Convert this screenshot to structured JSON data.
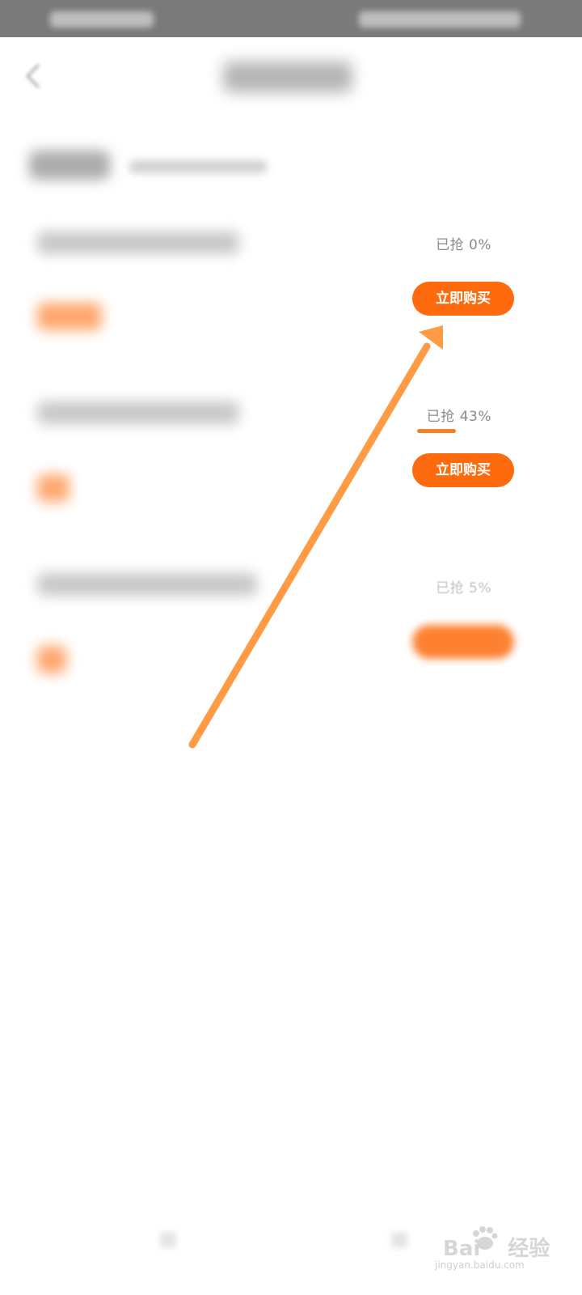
{
  "items": [
    {
      "grabbed": "已抢 0%",
      "progress": 0,
      "button": "立即购买"
    },
    {
      "grabbed": "已抢 43%",
      "progress": 0.43,
      "button": "立即购买"
    },
    {
      "grabbed": "已抢 5%",
      "progress": 0.05,
      "button": ""
    }
  ],
  "colors": {
    "accent": "#fe6b0e",
    "arrow": "#ff9a45"
  },
  "watermark": {
    "brand_left": "Bai",
    "brand_right": "经验",
    "sub": "jingyan.baidu.com"
  }
}
